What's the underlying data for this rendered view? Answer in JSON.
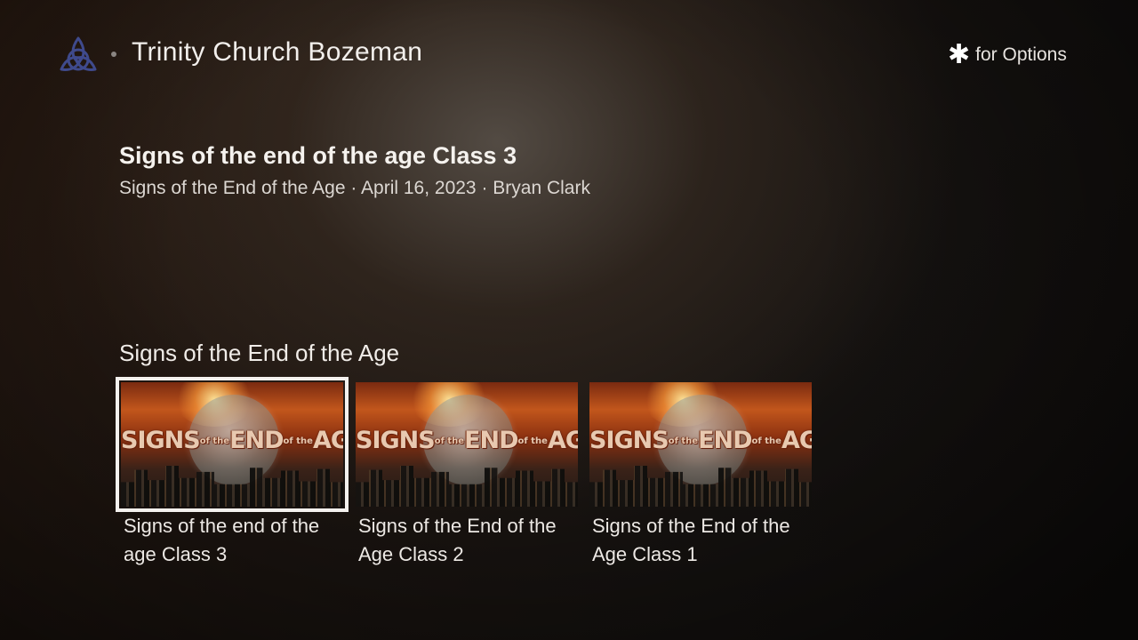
{
  "header": {
    "channel_title": "Trinity Church Bozeman",
    "options_label": "for Options",
    "options_glyph": "✱",
    "logo_icon": "triquetra-icon",
    "logo_color": "#3f4a8c"
  },
  "detail": {
    "title": "Signs of the end of the age Class 3",
    "meta": "Signs of the End of the Age · April 16, 2023 · Bryan Clark"
  },
  "row": {
    "title": "Signs of the End of the Age",
    "items": [
      {
        "label": "Signs of the end of the age Class 3",
        "focused": true
      },
      {
        "label": "Signs of the End of the Age Class 2",
        "focused": false
      },
      {
        "label": "Signs of the End of the Age Class 1",
        "focused": false
      }
    ],
    "thumbnail_text": {
      "word1": "SIGNS",
      "small1": "of the",
      "word2": "END",
      "small2": "of the",
      "word3": "AGE"
    }
  },
  "colors": {
    "focus_border": "#f4f1ee",
    "text_primary": "#ffffff"
  }
}
